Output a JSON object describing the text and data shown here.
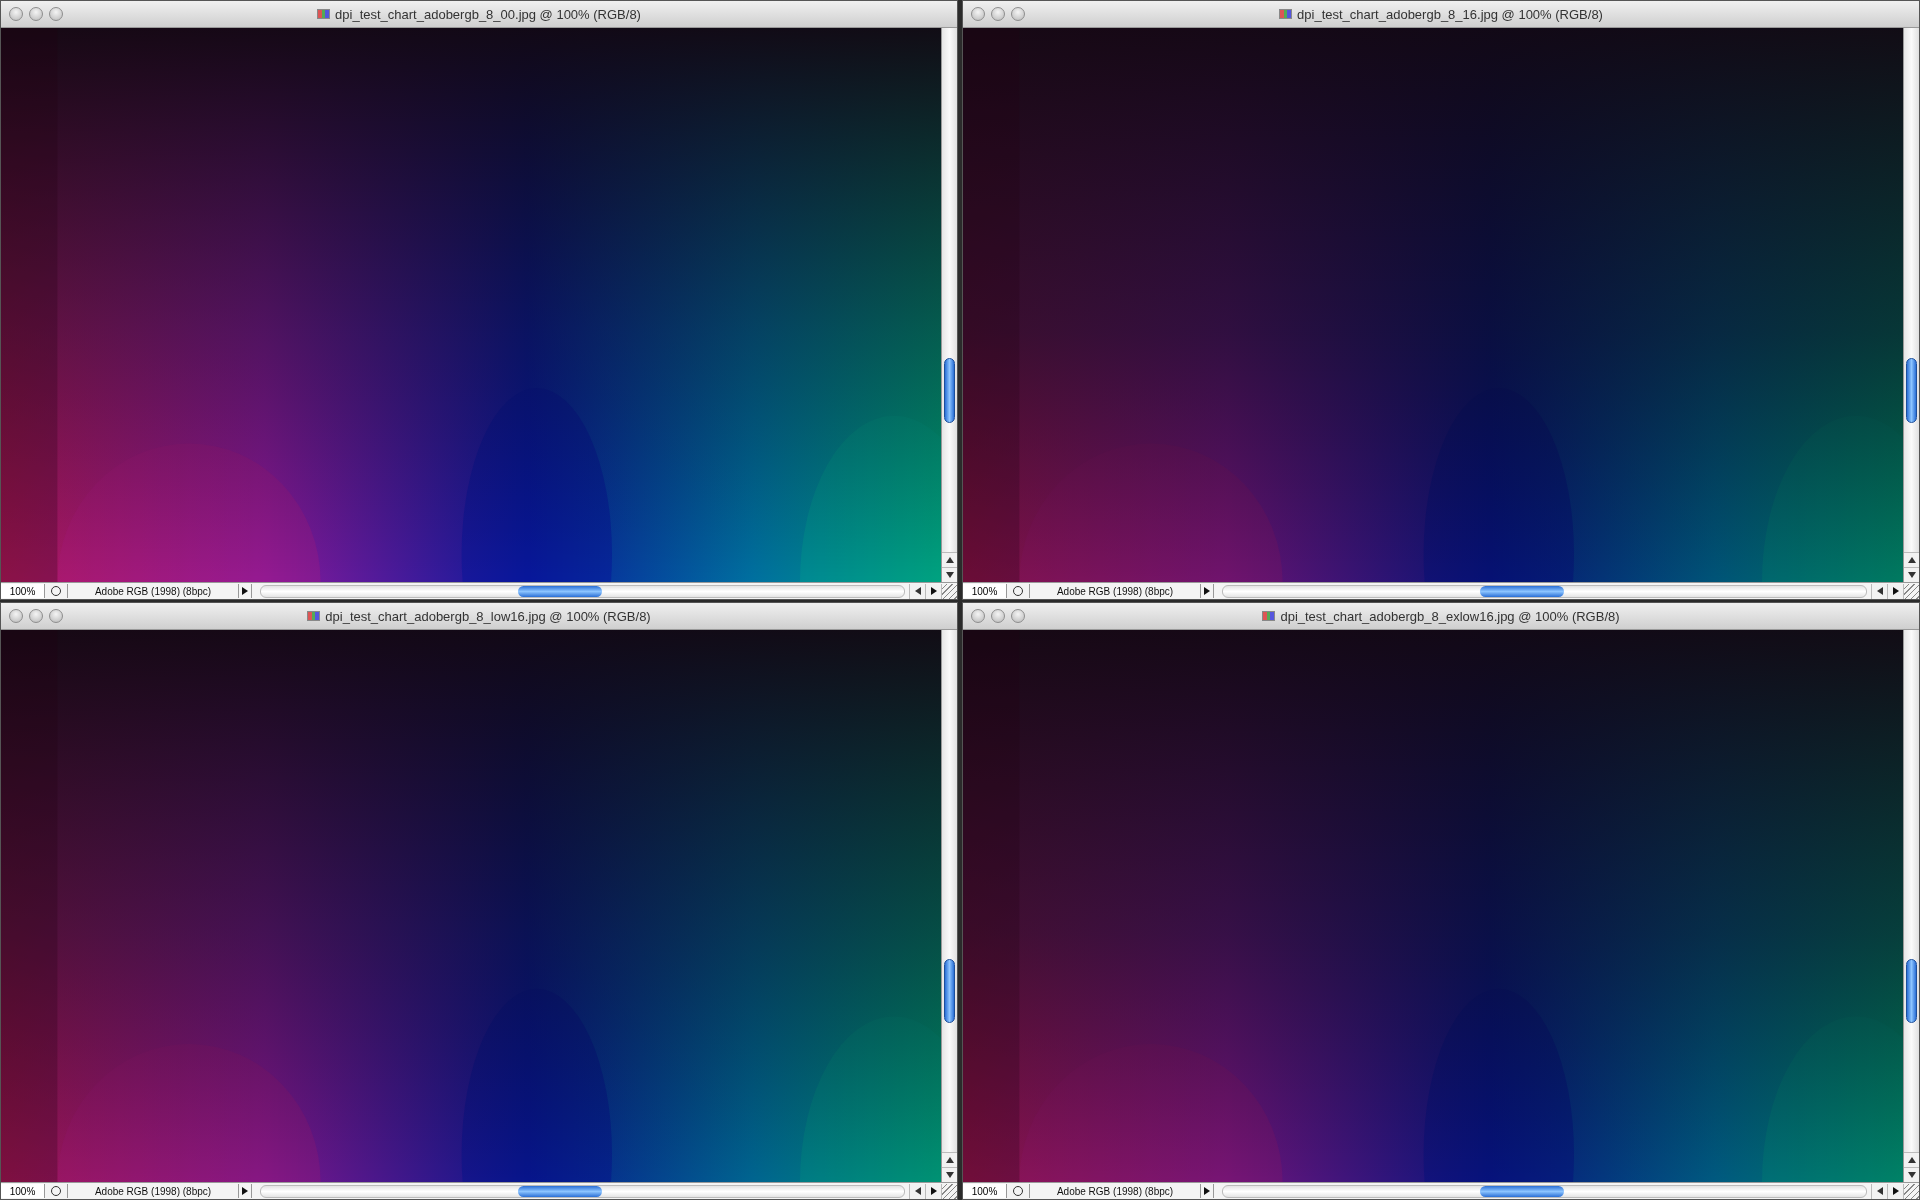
{
  "windows": [
    {
      "title": "dpi_test_chart_adobergb_8_00.jpg @ 100% (RGB/8)",
      "zoom": "100%",
      "profile": "Adobe RGB (1998) (8bpc)"
    },
    {
      "title": "dpi_test_chart_adobergb_8_16.jpg @ 100% (RGB/8)",
      "zoom": "100%",
      "profile": "Adobe RGB (1998) (8bpc)"
    },
    {
      "title": "dpi_test_chart_adobergb_8_low16.jpg @ 100% (RGB/8)",
      "zoom": "100%",
      "profile": "Adobe RGB (1998) (8bpc)"
    },
    {
      "title": "dpi_test_chart_adobergb_8_exlow16.jpg @ 100% (RGB/8)",
      "zoom": "100%",
      "profile": "Adobe RGB (1998) (8bpc)"
    }
  ]
}
